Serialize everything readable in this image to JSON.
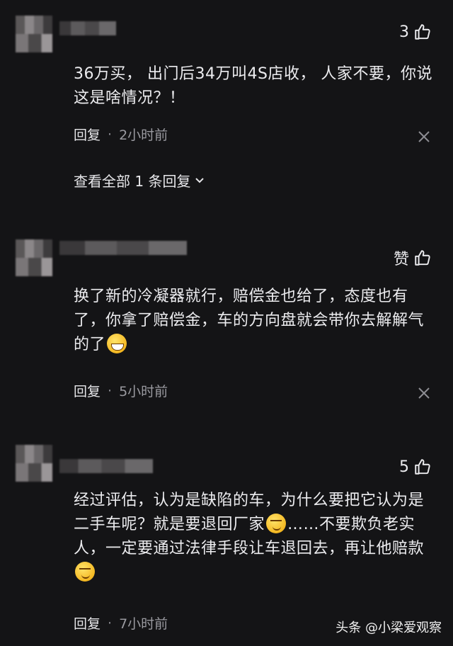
{
  "comments": [
    {
      "likes": "3",
      "text": "36万买，  出门后34万叫4S店收，  人家不要，你说这是啥情况？！",
      "reply_label": "回复",
      "dot": "·",
      "time": "2小时前",
      "view_replies": "查看全部 1 条回复"
    },
    {
      "likes": "赞",
      "text_a": "换了新的冷凝器就行，赔偿金也给了，态度也有了，你拿了赔偿金，车的方向盘就会带你去解解气的了",
      "reply_label": "回复",
      "dot": "·",
      "time": "5小时前"
    },
    {
      "likes": "5",
      "text_a": "经过评估，认为是缺陷的车，为什么要把它认为是二手车呢？就是要退回厂家",
      "text_b": "……不要欺负老实人，一定要通过法律手段让车退回去，再让他赔款",
      "reply_label": "回复",
      "dot": "·",
      "time": "7小时前"
    }
  ],
  "watermark": "头条 @小梁爱观察"
}
